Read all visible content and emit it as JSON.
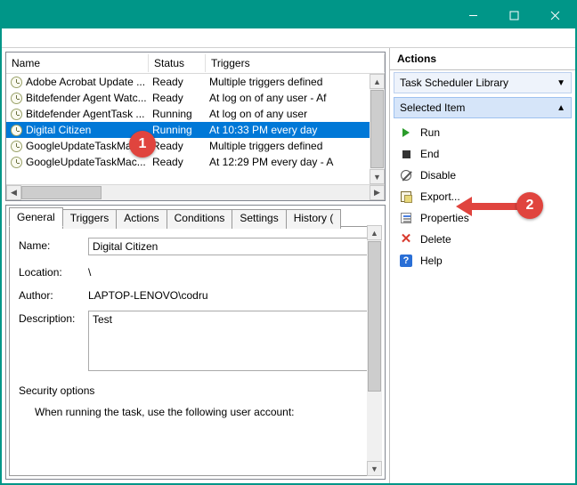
{
  "columns": {
    "name": "Name",
    "status": "Status",
    "triggers": "Triggers"
  },
  "tasks": [
    {
      "name": "Adobe Acrobat Update ...",
      "status": "Ready",
      "triggers": "Multiple triggers defined",
      "selected": false
    },
    {
      "name": "Bitdefender Agent Watc...",
      "status": "Ready",
      "triggers": "At log on of any user - Af",
      "selected": false
    },
    {
      "name": "Bitdefender AgentTask ...",
      "status": "Running",
      "triggers": "At log on of any user",
      "selected": false
    },
    {
      "name": "Digital Citizen",
      "status": "Running",
      "triggers": "At 10:33 PM every day",
      "selected": true
    },
    {
      "name": "GoogleUpdateTaskMac...",
      "status": "Ready",
      "triggers": "Multiple triggers defined",
      "selected": false
    },
    {
      "name": "GoogleUpdateTaskMac...",
      "status": "Ready",
      "triggers": "At 12:29 PM every day - A",
      "selected": false
    }
  ],
  "tabs": [
    "General",
    "Triggers",
    "Actions",
    "Conditions",
    "Settings",
    "History ("
  ],
  "detail": {
    "name_label": "Name:",
    "name_value": "Digital Citizen",
    "location_label": "Location:",
    "location_value": "\\",
    "author_label": "Author:",
    "author_value": "LAPTOP-LENOVO\\codru",
    "description_label": "Description:",
    "description_value": "Test",
    "security_header": "Security options",
    "security_text": "When running the task, use the following user account:"
  },
  "actions_panel": {
    "title": "Actions",
    "library": "Task Scheduler Library",
    "selected_header": "Selected Item",
    "items": {
      "run": "Run",
      "end": "End",
      "disable": "Disable",
      "export": "Export...",
      "properties": "Properties",
      "delete": "Delete",
      "help": "Help"
    }
  },
  "callouts": {
    "one": "1",
    "two": "2"
  }
}
